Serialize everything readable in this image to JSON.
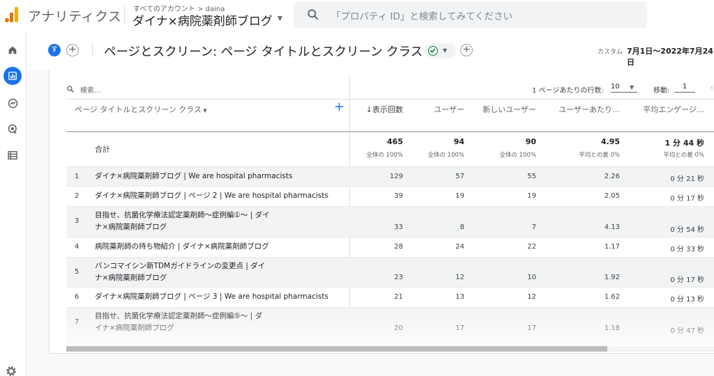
{
  "app": {
    "title": "アナリティクス",
    "account_crumb": "すべてのアカウント > daina",
    "account_name": "ダイナ×病院薬剤師ブログ",
    "search_placeholder": "「プロパティ ID」と検索してみてください"
  },
  "colors": {
    "accent": "#1a73e8",
    "logo_orange": "#f9ab00",
    "logo_dark_orange": "#e37400",
    "status_green": "#188038"
  },
  "rail": {
    "items": [
      {
        "name": "home-icon",
        "active": false
      },
      {
        "name": "reports-icon",
        "active": true
      },
      {
        "name": "explore-icon",
        "active": false
      },
      {
        "name": "advertising-icon",
        "active": false
      },
      {
        "name": "configure-icon",
        "active": false
      }
    ],
    "settings_icon": "gear-icon"
  },
  "titlebar": {
    "avatar_letter": "す",
    "page_title": "ページとスクリーン: ページ タイトルとスクリーン クラス",
    "custom_label": "カスタム",
    "date_range": "7月1日～2022年7月24日"
  },
  "table": {
    "search_placeholder": "検索...",
    "rows_per_page_label": "1 ページあたりの行数:",
    "rows_per_page_value": "10",
    "goto_label": "移動:",
    "goto_value": "1",
    "dimension_header": "ページ タイトルとスクリーン クラス",
    "metric_headers": [
      "↓表示回数",
      "ユーザー",
      "新しいユーザー",
      "ユーザーあたり…",
      "平均エンゲージ…"
    ],
    "total": {
      "label": "合計",
      "values": [
        "465",
        "94",
        "90",
        "4.95",
        "1 分 44 秒"
      ],
      "subs": [
        "全体の 100%",
        "全体の 100%",
        "全体の 100%",
        "平均との差 0%",
        "平均との差 0%"
      ]
    },
    "rows": [
      {
        "idx": "1",
        "title": "ダイナ×病院薬剤師ブログ | We are hospital pharmacists",
        "views": "129",
        "users": "57",
        "new_users": "55",
        "per_user": "2.26",
        "engagement": "0 分 21 秒"
      },
      {
        "idx": "2",
        "title": "ダイナ×病院薬剤師ブログ | ページ 2 | We are hospital pharmacists",
        "views": "39",
        "users": "19",
        "new_users": "19",
        "per_user": "2.05",
        "engagement": "0 分 17 秒"
      },
      {
        "idx": "3",
        "title": "目指せ、抗菌化学療法認定薬剤師～症例編①～ | ダイナ×病院薬剤師ブログ",
        "views": "33",
        "users": "8",
        "new_users": "7",
        "per_user": "4.13",
        "engagement": "0 分 54 秒"
      },
      {
        "idx": "4",
        "title": "病院薬剤師の持ち物紹介 | ダイナ×病院薬剤師ブログ",
        "views": "28",
        "users": "24",
        "new_users": "22",
        "per_user": "1.17",
        "engagement": "0 分 33 秒"
      },
      {
        "idx": "5",
        "title": "バンコマイシン新TDMガイドラインの変更点 | ダイナ×病院薬剤師ブログ",
        "views": "23",
        "users": "12",
        "new_users": "10",
        "per_user": "1.92",
        "engagement": "0 分 17 秒"
      },
      {
        "idx": "6",
        "title": "ダイナ×病院薬剤師ブログ | ページ 3 | We are hospital pharmacists",
        "views": "21",
        "users": "13",
        "new_users": "12",
        "per_user": "1.62",
        "engagement": "0 分 13 秒"
      },
      {
        "idx": "7",
        "title": "目指せ、抗菌化学療法認定薬剤師～症例編⑤～ | ダイナ×病院薬剤師ブログ",
        "views": "20",
        "users": "17",
        "new_users": "17",
        "per_user": "1.18",
        "engagement": "0 分 47 秒"
      }
    ]
  }
}
